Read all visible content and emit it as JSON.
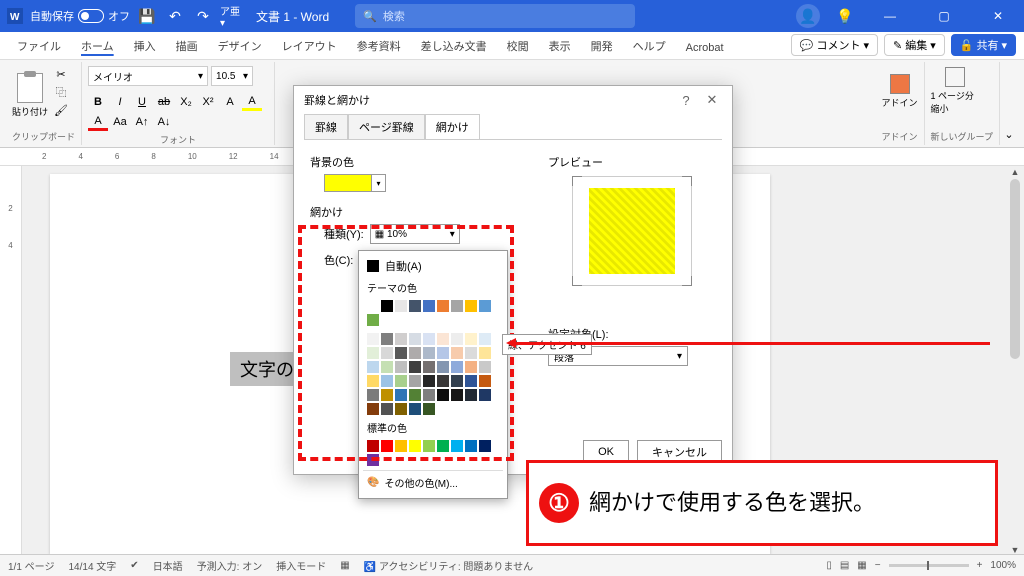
{
  "titlebar": {
    "autosave_label": "自動保存",
    "autosave_state": "オフ",
    "doc_title": "文書 1 - Word",
    "search_placeholder": "検索"
  },
  "menubar": {
    "items": [
      "ファイル",
      "ホーム",
      "挿入",
      "描画",
      "デザイン",
      "レイアウト",
      "参考資料",
      "差し込み文書",
      "校閲",
      "表示",
      "開発",
      "ヘルプ",
      "Acrobat"
    ],
    "comment": "コメント",
    "edit": "編集",
    "share": "共有"
  },
  "ribbon": {
    "clipboard": {
      "paste": "貼り付け",
      "label": "クリップボード"
    },
    "font": {
      "name": "メイリオ",
      "size": "10.5",
      "label": "フォント"
    },
    "addins": {
      "addin": "アドイン",
      "page_shrink": "1 ページ分縮小",
      "label1": "アドイン",
      "label2": "新しいグループ"
    }
  },
  "document": {
    "selected_text": "文字の網"
  },
  "dialog": {
    "title": "罫線と網かけ",
    "tabs": [
      "罫線",
      "ページ罫線",
      "網かけ"
    ],
    "fill_label": "背景の色",
    "pattern_label": "網かけ",
    "type_label": "種類(Y):",
    "type_value": "10%",
    "color_label": "色(C):",
    "color_value": "自動",
    "preview_label": "プレビュー",
    "target_label": "設定対象(L):",
    "target_value": "段落",
    "ok": "OK",
    "cancel": "キャンセル"
  },
  "color_popup": {
    "auto": "自動(A)",
    "theme": "テーマの色",
    "standard": "標準の色",
    "more": "その他の色(M)...",
    "tooltip": "緑、アクセント 6",
    "theme_colors_row1": [
      "#ffffff",
      "#000000",
      "#e7e6e6",
      "#44546a",
      "#4472c4",
      "#ed7d31",
      "#a5a5a5",
      "#ffc000",
      "#5b9bd5",
      "#70ad47"
    ],
    "theme_shades": [
      [
        "#f2f2f2",
        "#7f7f7f",
        "#d0cece",
        "#d6dce4",
        "#d9e2f3",
        "#fbe5d5",
        "#ededed",
        "#fff2cc",
        "#deebf6",
        "#e2efd9"
      ],
      [
        "#d8d8d8",
        "#595959",
        "#aeabab",
        "#adb9ca",
        "#b4c6e7",
        "#f7cbac",
        "#dbdbdb",
        "#fee599",
        "#bdd7ee",
        "#c5e0b3"
      ],
      [
        "#bfbfbf",
        "#3f3f3f",
        "#757070",
        "#8496b0",
        "#8eaadb",
        "#f4b183",
        "#c9c9c9",
        "#ffd965",
        "#9cc3e5",
        "#a8d08d"
      ],
      [
        "#a5a5a5",
        "#262626",
        "#3a3838",
        "#323f4f",
        "#2f5496",
        "#c55a11",
        "#7b7b7b",
        "#bf9000",
        "#2e75b5",
        "#538135"
      ],
      [
        "#7f7f7f",
        "#0c0c0c",
        "#171616",
        "#222a35",
        "#1f3864",
        "#833c0b",
        "#525252",
        "#7f6000",
        "#1e4e79",
        "#375623"
      ]
    ],
    "standard_colors": [
      "#c00000",
      "#ff0000",
      "#ffc000",
      "#ffff00",
      "#92d050",
      "#00b050",
      "#00b0f0",
      "#0070c0",
      "#002060",
      "#7030a0"
    ]
  },
  "statusbar": {
    "page": "1/1 ページ",
    "words": "14/14 文字",
    "lang": "日本語",
    "predict": "予測入力: オン",
    "insert": "挿入モード",
    "acc": "アクセシビリティ: 問題ありません",
    "zoom": "100%"
  },
  "callout": {
    "num": "①",
    "text": "網かけで使用する色を選択。"
  }
}
